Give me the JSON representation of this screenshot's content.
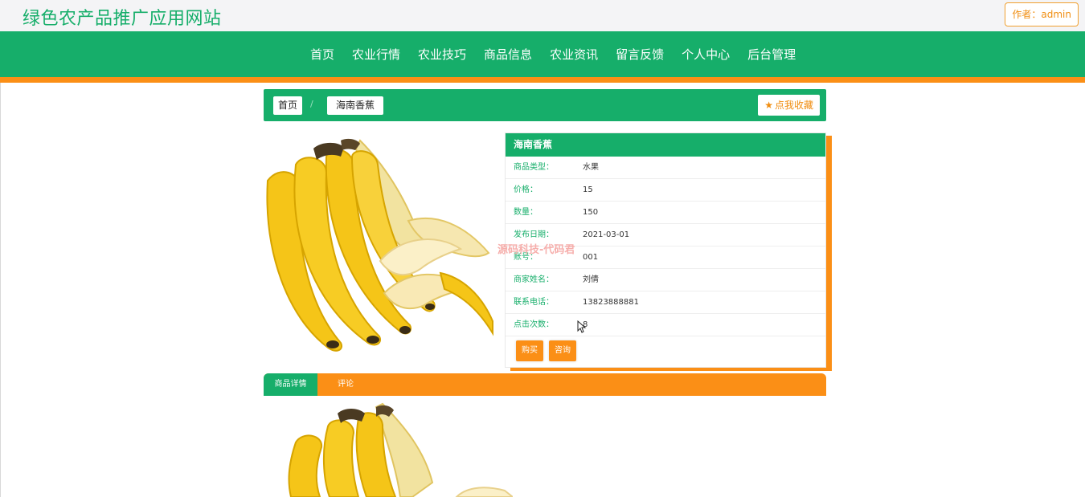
{
  "header": {
    "site_title": "绿色农产品推广应用网站",
    "author_label": "作者：admin"
  },
  "nav": {
    "items": [
      "首页",
      "农业行情",
      "农业技巧",
      "商品信息",
      "农业资讯",
      "留言反馈",
      "个人中心",
      "后台管理"
    ]
  },
  "breadcrumb": {
    "home": "首页",
    "separator": "/",
    "current": "海南香蕉",
    "favorite_label": "点我收藏"
  },
  "product": {
    "title": "海南香蕉",
    "fields": [
      {
        "label": "商品类型：",
        "value": "水果"
      },
      {
        "label": "价格：",
        "value": "15"
      },
      {
        "label": "数量：",
        "value": "150"
      },
      {
        "label": "发布日期：",
        "value": "2021-03-01"
      },
      {
        "label": "账号：",
        "value": "001"
      },
      {
        "label": "商家姓名：",
        "value": "刘倩"
      },
      {
        "label": "联系电话：",
        "value": "13823888881"
      },
      {
        "label": "点击次数：",
        "value": "8"
      }
    ],
    "buy_label": "购买",
    "ask_label": "咨询"
  },
  "tabs": {
    "detail": "商品详情",
    "comment": "评论"
  },
  "watermark": "源码科技-代码君",
  "colors": {
    "brand_green": "#16ae6a",
    "accent_orange": "#fb8f16",
    "banana_yellow": "#f5c518"
  },
  "icons": {
    "favorite": "star-icon",
    "cursor": "mouse-cursor-icon"
  }
}
